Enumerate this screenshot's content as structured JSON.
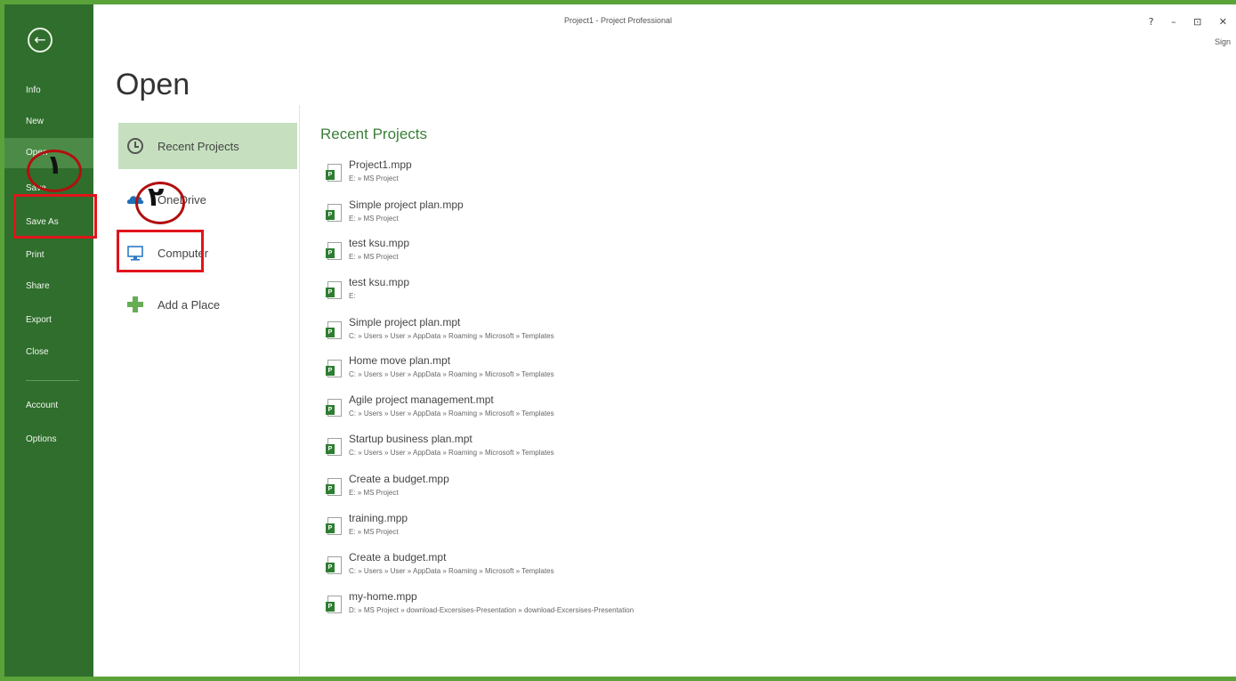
{
  "window": {
    "title": "Project1 - Project Professional",
    "controls": "? – ⊡ ✕",
    "sign_in": "Sign"
  },
  "nav": {
    "back_icon": "←",
    "items": [
      {
        "label": "Info"
      },
      {
        "label": "New"
      },
      {
        "label": "Open"
      },
      {
        "label": "Save"
      },
      {
        "label": "Save As"
      },
      {
        "label": "Print"
      },
      {
        "label": "Share"
      },
      {
        "label": "Export"
      },
      {
        "label": "Close"
      },
      {
        "label": "Account"
      },
      {
        "label": "Options"
      }
    ]
  },
  "page": {
    "title": "Open"
  },
  "places": [
    {
      "label": "Recent Projects",
      "icon": "clock-icon"
    },
    {
      "label": "OneDrive",
      "icon": "cloud-icon"
    },
    {
      "label": "Computer",
      "icon": "computer-icon"
    },
    {
      "label": "Add a Place",
      "icon": "plus-icon"
    }
  ],
  "recent": {
    "heading": "Recent Projects",
    "files": [
      {
        "name": "Project1.mpp",
        "path": "E: » MS Project"
      },
      {
        "name": "Simple project plan.mpp",
        "path": "E: » MS Project"
      },
      {
        "name": "test ksu.mpp",
        "path": "E: » MS Project"
      },
      {
        "name": "test ksu.mpp",
        "path": "E:"
      },
      {
        "name": "Simple project plan.mpt",
        "path": "C: » Users » User » AppData » Roaming » Microsoft » Templates"
      },
      {
        "name": "Home move plan.mpt",
        "path": "C: » Users » User » AppData » Roaming » Microsoft » Templates"
      },
      {
        "name": "Agile project management.mpt",
        "path": "C: » Users » User » AppData » Roaming » Microsoft » Templates"
      },
      {
        "name": "Startup business plan.mpt",
        "path": "C: » Users » User » AppData » Roaming » Microsoft » Templates"
      },
      {
        "name": "Create a budget.mpp",
        "path": "E: » MS Project"
      },
      {
        "name": "training.mpp",
        "path": "E: » MS Project"
      },
      {
        "name": "Create a budget.mpt",
        "path": "C: » Users » User » AppData » Roaming » Microsoft » Templates"
      },
      {
        "name": "my-home.mpp",
        "path": "D: » MS Project » download-Excersises-Presentation » download-Excersises-Presentation"
      }
    ]
  },
  "annotations": {
    "step1": "١",
    "step2": "٢"
  },
  "colors": {
    "nav_bg": "#2f6e2c",
    "accent": "#3b7f38",
    "selected_place": "#c6e0bf",
    "highlight_red": "#e1141b"
  }
}
